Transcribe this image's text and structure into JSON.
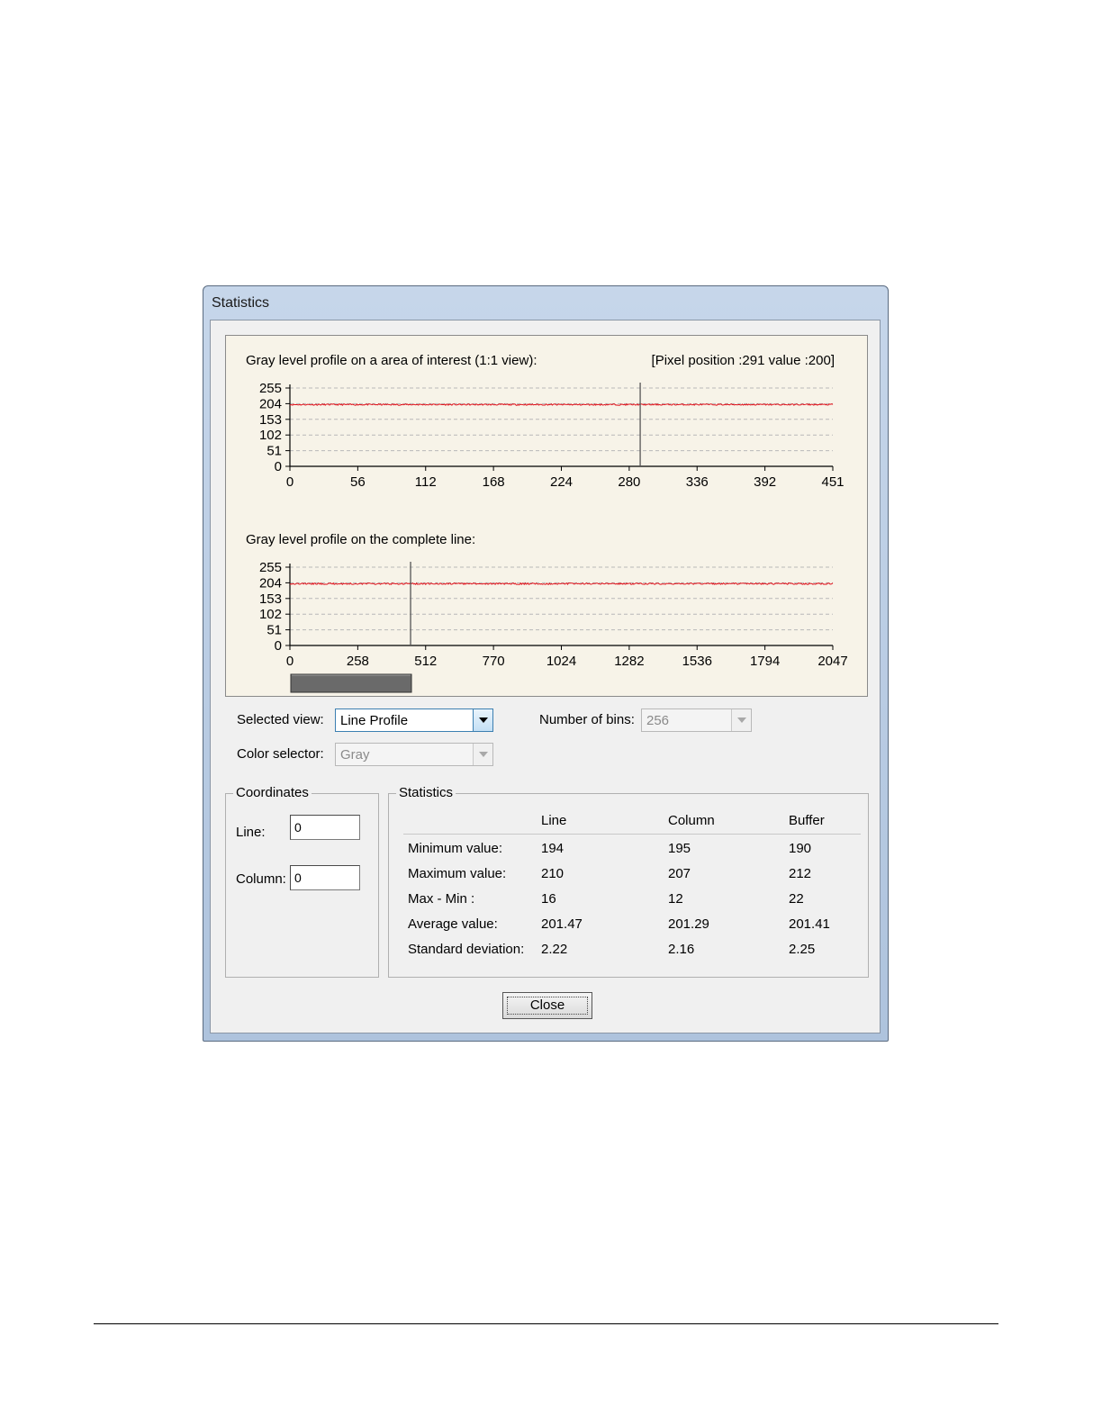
{
  "window": {
    "title": "Statistics"
  },
  "chart_data": [
    {
      "type": "line",
      "title": "Gray level profile on a area of interest (1:1 view):",
      "readout": "[Pixel position :291  value :200]",
      "x_ticks": [
        "0",
        "56",
        "112",
        "168",
        "224",
        "280",
        "336",
        "392",
        "451"
      ],
      "y_ticks": [
        "0",
        "51",
        "102",
        "153",
        "204",
        "255"
      ],
      "xlim": [
        0,
        451
      ],
      "ylim": [
        0,
        255
      ],
      "cursor_x": 291,
      "series": [
        {
          "approx_level": 201,
          "min": 194,
          "max": 210,
          "color": "#e0101a"
        }
      ]
    },
    {
      "type": "line",
      "title": "Gray level profile on the complete line:",
      "x_ticks": [
        "0",
        "258",
        "512",
        "770",
        "1024",
        "1282",
        "1536",
        "1794",
        "2047"
      ],
      "y_ticks": [
        "0",
        "51",
        "102",
        "153",
        "204",
        "255"
      ],
      "xlim": [
        0,
        2047
      ],
      "ylim": [
        0,
        255
      ],
      "cursor_x": 455,
      "series": [
        {
          "approx_level": 201,
          "min": 190,
          "max": 212,
          "color": "#e0101a"
        }
      ]
    }
  ],
  "controls": {
    "selected_view_label": "Selected view:",
    "selected_view_value": "Line Profile",
    "color_selector_label": "Color selector:",
    "color_selector_value": "Gray",
    "bins_label": "Number of bins:",
    "bins_value": "256"
  },
  "coordinates": {
    "title": "Coordinates",
    "line_label": "Line:",
    "line_value": "0",
    "column_label": "Column:",
    "column_value": "0"
  },
  "statistics": {
    "title": "Statistics",
    "columns": [
      "Line",
      "Column",
      "Buffer"
    ],
    "rows": [
      {
        "label": "Minimum value:",
        "values": [
          "194",
          "195",
          "190"
        ]
      },
      {
        "label": "Maximum value:",
        "values": [
          "210",
          "207",
          "212"
        ]
      },
      {
        "label": "Max - Min :",
        "values": [
          "16",
          "12",
          "22"
        ]
      },
      {
        "label": "Average value:",
        "values": [
          "201.47",
          "201.29",
          "201.41"
        ]
      },
      {
        "label": "Standard deviation:",
        "values": [
          "2.22",
          "2.16",
          "2.25"
        ]
      }
    ]
  },
  "buttons": {
    "close": "Close"
  }
}
